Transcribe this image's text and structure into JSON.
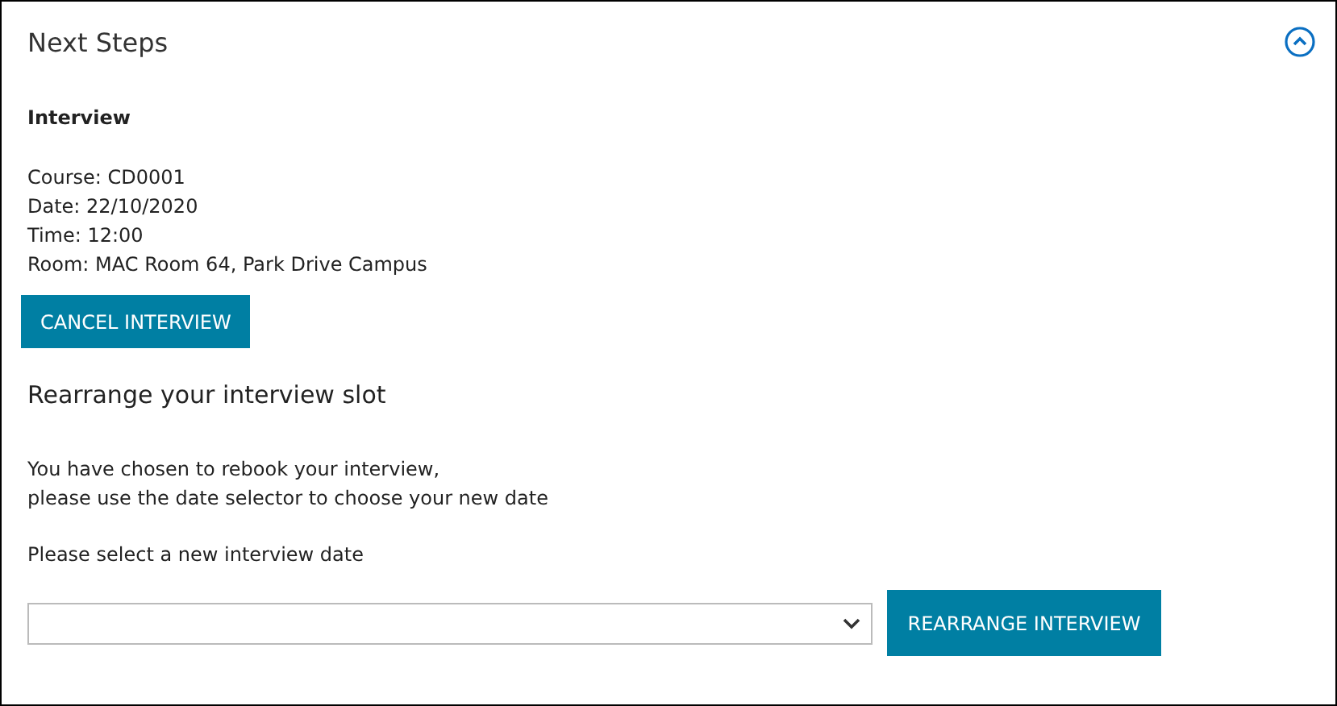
{
  "panel": {
    "title": "Next Steps",
    "expanded": true
  },
  "interview": {
    "heading": "Interview",
    "details": [
      "Course: CD0001",
      "Date: 22/10/2020",
      "Time: 12:00",
      "Room: MAC Room 64, Park Drive Campus"
    ],
    "cancel_button": "CANCEL INTERVIEW"
  },
  "rearrange": {
    "heading": "Rearrange your interview slot",
    "message_lines": [
      "You have chosen to rebook your interview,",
      "please use the date selector to choose your new date"
    ],
    "date_label": "Please select a new interview date",
    "submit_button": "REARRANGE INTERVIEW"
  }
}
